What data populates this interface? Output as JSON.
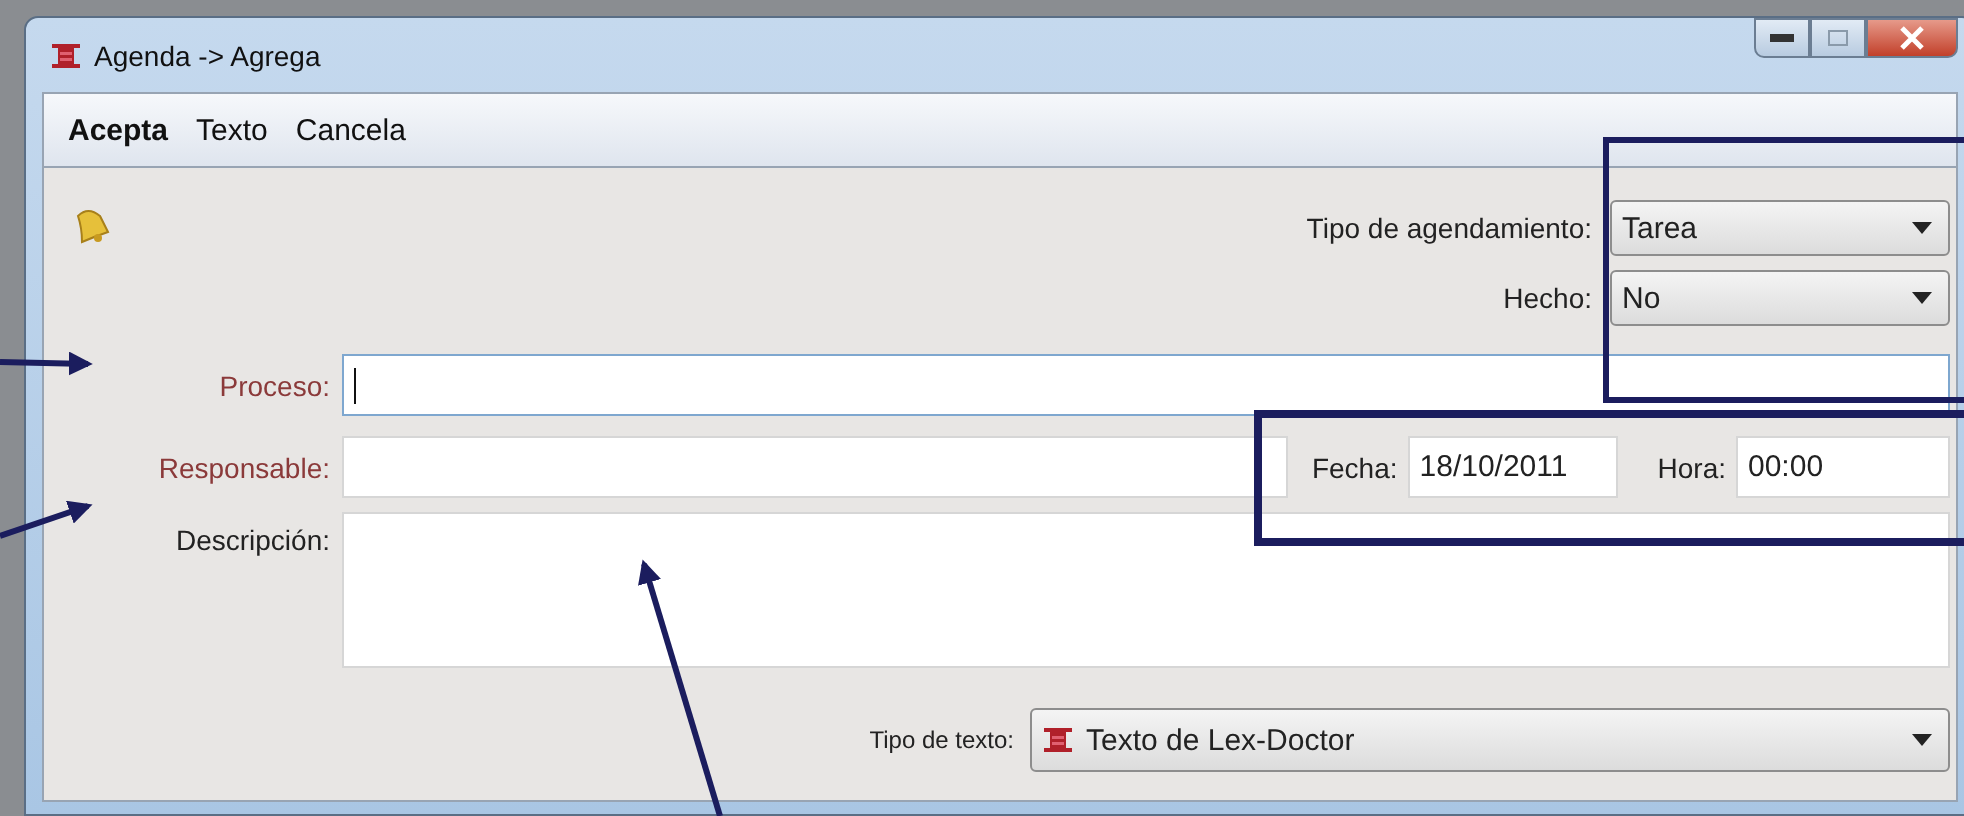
{
  "window": {
    "title": "Agenda -> Agrega"
  },
  "menu": [
    {
      "label": "Acepta",
      "default": true
    },
    {
      "label": "Texto",
      "default": false
    },
    {
      "label": "Cancela",
      "default": false
    }
  ],
  "tipo_agendamiento": {
    "label": "Tipo de agendamiento:",
    "value": "Tarea"
  },
  "hecho": {
    "label": "Hecho:",
    "value": "No"
  },
  "proceso": {
    "label": "Proceso:",
    "required": true,
    "focused": true
  },
  "responsable": {
    "label": "Responsable:",
    "required": true,
    "focused": false
  },
  "fecha": {
    "label": "Fecha:",
    "value": "18/10/2011"
  },
  "hora": {
    "label": "Hora:",
    "value": "00:00"
  },
  "descripcion": {
    "label": "Descripción:",
    "required": false
  },
  "tipo_texto": {
    "label": "Tipo de texto:",
    "value": "Texto de Lex-Doctor"
  }
}
